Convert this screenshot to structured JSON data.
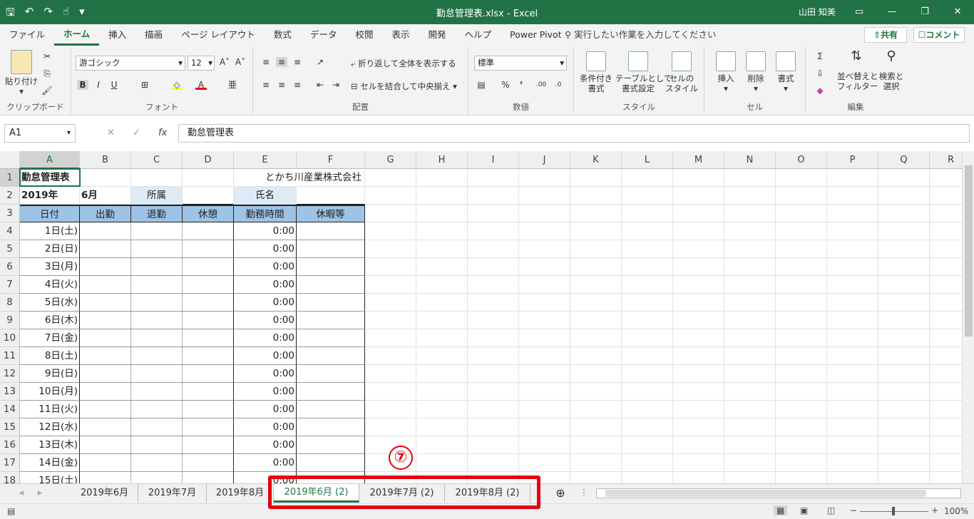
{
  "window": {
    "title": "勤怠管理表.xlsx  -  Excel",
    "user": "山田 知美"
  },
  "menu": {
    "tabs": [
      "ファイル",
      "ホーム",
      "挿入",
      "描画",
      "ページ レイアウト",
      "数式",
      "データ",
      "校閲",
      "表示",
      "開発",
      "ヘルプ",
      "Power Pivot"
    ],
    "active": "ホーム",
    "tell_me": "実行したい作業を入力してください",
    "share": "共有",
    "comment": "コメント"
  },
  "ribbon": {
    "clipboard": {
      "label": "クリップボード",
      "paste": "貼り付け"
    },
    "font": {
      "label": "フォント",
      "name": "游ゴシック",
      "size": "12",
      "bold": "B",
      "italic": "I",
      "underline": "U"
    },
    "alignment": {
      "label": "配置",
      "wrap": "折り返して全体を表示する",
      "merge": "セルを結合して中央揃え"
    },
    "number": {
      "label": "数値",
      "format": "標準"
    },
    "styles": {
      "label": "スタイル",
      "cond": "条件付き\n書式",
      "table": "テーブルとして\n書式設定",
      "cell": "セルの\nスタイル"
    },
    "cells": {
      "label": "セル",
      "insert": "挿入",
      "delete": "削除",
      "format": "書式"
    },
    "editing": {
      "label": "編集",
      "sort": "並べ替えと\nフィルター",
      "find": "検索と\n選択"
    }
  },
  "formula_bar": {
    "name_box": "A1",
    "content": "勤怠管理表"
  },
  "columns": [
    "A",
    "B",
    "C",
    "D",
    "E",
    "F",
    "G",
    "H",
    "I",
    "J",
    "K",
    "L",
    "M",
    "N",
    "O",
    "P",
    "Q",
    "R"
  ],
  "sheet": {
    "row1": {
      "a": "勤怠管理表",
      "company": "とかち川産業株式会社"
    },
    "row2": {
      "year": "2019年",
      "month": "6月",
      "dept_label": "所属",
      "name_label": "氏名"
    },
    "headers": [
      "日付",
      "出勤",
      "退勤",
      "休憩",
      "勤務時間",
      "休暇等"
    ],
    "days": [
      "1日(土)",
      "2日(日)",
      "3日(月)",
      "4日(火)",
      "5日(水)",
      "6日(木)",
      "7日(金)",
      "8日(土)",
      "9日(日)",
      "10日(月)",
      "11日(火)",
      "12日(水)",
      "13日(木)",
      "14日(金)",
      "15日(土)"
    ],
    "work_time": "0:00"
  },
  "sheet_tabs": [
    "2019年6月",
    "2019年7月",
    "2019年8月",
    "2019年6月 (2)",
    "2019年7月 (2)",
    "2019年8月 (2)"
  ],
  "active_sheet_tab": "2019年6月 (2)",
  "annotation": {
    "marker": "⑦"
  },
  "status": {
    "zoom": "100%"
  }
}
